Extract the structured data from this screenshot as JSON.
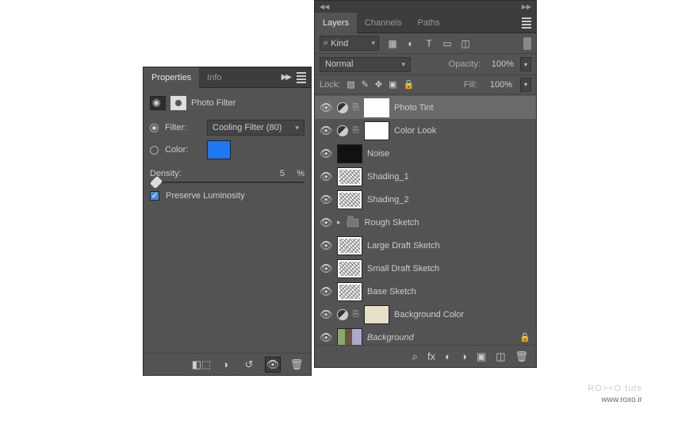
{
  "properties": {
    "tabs": [
      "Properties",
      "Info"
    ],
    "title": "Photo Filter",
    "filter_label": "Filter:",
    "filter_value": "Cooling Filter (80)",
    "color_label": "Color:",
    "color_hex": "#1e78f0",
    "density_label": "Density:",
    "density_value": "5",
    "density_unit": "%",
    "preserve_label": "Preserve Luminosity",
    "preserve_checked": true
  },
  "layers": {
    "tabs": [
      "Layers",
      "Channels",
      "Paths"
    ],
    "kind_label": "Kind",
    "blend_mode": "Normal",
    "opacity_label": "Opacity:",
    "opacity_value": "100%",
    "lock_label": "Lock:",
    "fill_label": "Fill:",
    "fill_value": "100%",
    "items": [
      {
        "name": "Photo Tint",
        "type": "adj",
        "selected": true
      },
      {
        "name": "Color Look",
        "type": "adj"
      },
      {
        "name": "Noise",
        "type": "img",
        "thumb": "dark"
      },
      {
        "name": "Shading_1",
        "type": "img",
        "thumb": "sketch"
      },
      {
        "name": "Shading_2",
        "type": "img",
        "thumb": "sketch"
      },
      {
        "name": "Rough Sketch",
        "type": "group"
      },
      {
        "name": "Large Draft Sketch",
        "type": "img",
        "thumb": "sketch"
      },
      {
        "name": "Small Draft Sketch",
        "type": "img",
        "thumb": "sketch"
      },
      {
        "name": "Base Sketch",
        "type": "img",
        "thumb": "sketch"
      },
      {
        "name": "Background Color",
        "type": "fill",
        "thumb": "beige"
      },
      {
        "name": "Background",
        "type": "bg",
        "thumb": "photo",
        "locked": true
      }
    ]
  },
  "watermark": {
    "logo_main": "RO><O",
    "logo_sub": " tuts",
    "url": "www.roxo.ir"
  }
}
